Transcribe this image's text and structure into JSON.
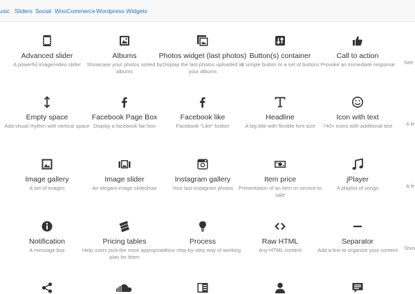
{
  "top_links": [
    "usic",
    "Sliders",
    "Social",
    "WooCommerce",
    "Wordpress Widgets"
  ],
  "widgets": [
    {
      "title": "Advanced slider",
      "desc": "A powerful image/video slider",
      "icon": "video-film-icon"
    },
    {
      "title": "Albums",
      "desc": "Showcase your photos sorted by albums",
      "icon": "photo-album-icon"
    },
    {
      "title": "Photos widget (last photos)",
      "desc": "Display the last photos uploaded in your albums",
      "icon": "photos-widget-icon"
    },
    {
      "title": "Button(s) container",
      "desc": "A simple button or a set of buttons",
      "icon": "buttons-container-icon"
    },
    {
      "title": "Call to action",
      "desc": "Provoke an immediate response",
      "icon": "thumbs-up-icon"
    },
    {
      "title": "Empty space",
      "desc": "Add visual rhythm with vertical space",
      "icon": "vertical-arrows-icon"
    },
    {
      "title": "Facebook Page Box",
      "desc": "Display a facebook fan box",
      "icon": "facebook-icon"
    },
    {
      "title": "Facebook like",
      "desc": "Facebook \"Like\" button",
      "icon": "facebook-icon"
    },
    {
      "title": "Headline",
      "desc": "A big title with flexible font size",
      "icon": "text-icon"
    },
    {
      "title": "Icon with text",
      "desc": "740+ icons with additional text",
      "icon": "smiley-icon"
    },
    {
      "title": "Image gallery",
      "desc": "A set of images",
      "icon": "image-gallery-icon"
    },
    {
      "title": "Image slider",
      "desc": "An elegant image slideshow",
      "icon": "image-slider-icon"
    },
    {
      "title": "Instagram gallery",
      "desc": "Your last instagram photos",
      "icon": "instagram-icon"
    },
    {
      "title": "Item price",
      "desc": "Presentation of an item or service to sale",
      "icon": "money-icon"
    },
    {
      "title": "jPlayer",
      "desc": "A playlist of songs",
      "icon": "music-note-icon"
    },
    {
      "title": "Notification",
      "desc": "A message box",
      "icon": "info-icon"
    },
    {
      "title": "Pricing tables",
      "desc": "Help users pick the most appropriate plan for them",
      "icon": "pricing-tables-icon"
    },
    {
      "title": "Process",
      "desc": "Your step-by-step way of working",
      "icon": "lightbulb-icon"
    },
    {
      "title": "Raw HTML",
      "desc": "Any HTML content",
      "icon": "code-icon"
    },
    {
      "title": "Separator",
      "desc": "Add a line to organize your content",
      "icon": "separator-icon"
    },
    {
      "title": "",
      "desc": "",
      "icon": "share-icon"
    },
    {
      "title": "",
      "desc": "",
      "icon": "soundcloud-icon"
    },
    {
      "title": "",
      "desc": "",
      "icon": "columns-icon"
    },
    {
      "title": "",
      "desc": "",
      "icon": "user-icon"
    },
    {
      "title": "",
      "desc": "",
      "icon": "testimonial-icon"
    }
  ],
  "edge_snippets": [
    "See th",
    "A lin",
    "A lin",
    "Show"
  ]
}
